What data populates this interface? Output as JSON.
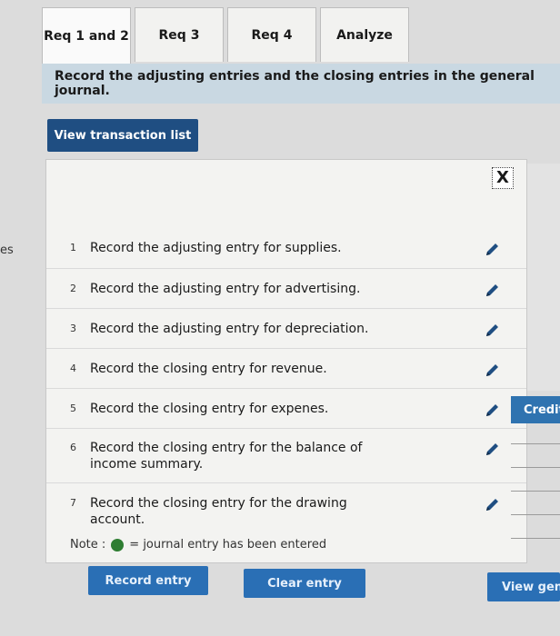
{
  "tabs": [
    {
      "label": "Req 1 and 2",
      "active": true
    },
    {
      "label": "Req 3",
      "active": false
    },
    {
      "label": "Req 4",
      "active": false
    },
    {
      "label": "Analyze",
      "active": false
    }
  ],
  "banner": {
    "text": "Record the adjusting entries and the closing entries in the general journal."
  },
  "view_transactions_label": "View transaction list",
  "left_edge_text": "es",
  "close_symbol": "X",
  "transactions": [
    {
      "num": "1",
      "text": "Record the adjusting entry for supplies."
    },
    {
      "num": "2",
      "text": "Record the adjusting entry for advertising."
    },
    {
      "num": "3",
      "text": "Record the adjusting entry for depreciation."
    },
    {
      "num": "4",
      "text": "Record the closing entry for revenue."
    },
    {
      "num": "5",
      "text": "Record the closing entry for expenes."
    },
    {
      "num": "6",
      "text": "Record the closing entry for the balance of income summary."
    },
    {
      "num": "7",
      "text": "Record the closing entry for the drawing account."
    }
  ],
  "note": {
    "prefix": "Note :",
    "suffix": "= journal entry has been entered"
  },
  "buttons": {
    "record": "Record entry",
    "clear": "Clear entry",
    "view_general": "View gener"
  },
  "credit_header": "Credit",
  "colors": {
    "primary": "#1f4e82",
    "accent": "#2a6fb5",
    "entered_dot": "#2e7d32",
    "banner": "#c9d8e2"
  },
  "icons": {
    "edit": "pencil-icon",
    "close": "close-icon"
  }
}
